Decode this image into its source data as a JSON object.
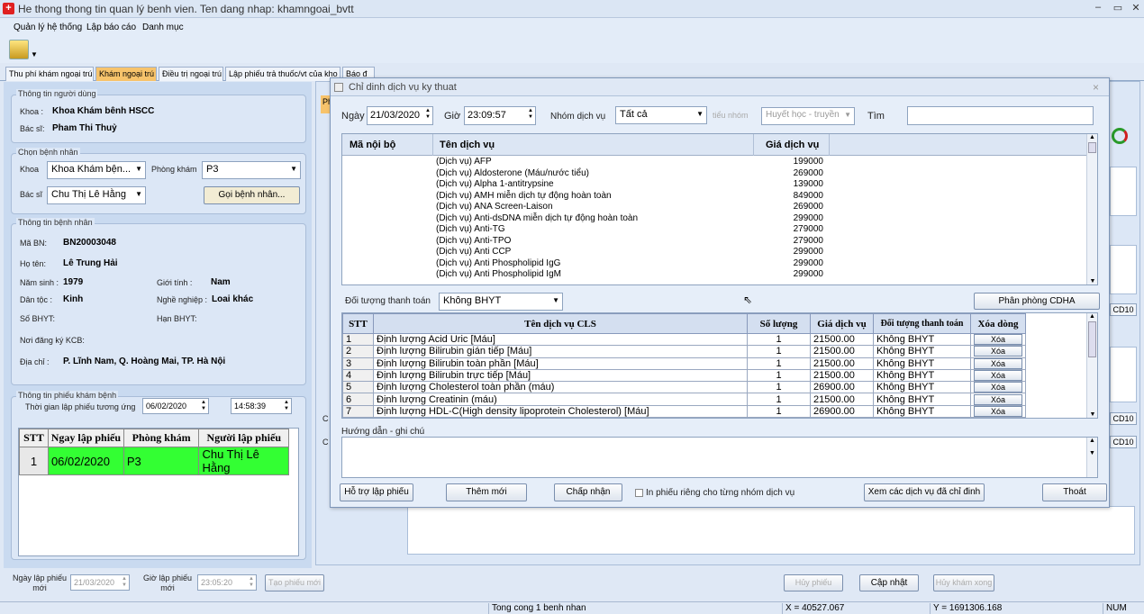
{
  "window": {
    "title": "He thong thong tin quan lý benh vien. Ten dang nhap: khamngoai_bvtt"
  },
  "menu": [
    "Quản lý hệ thống",
    "Lập báo cáo",
    "Danh mục"
  ],
  "tabs": [
    "Thu phí khám ngoại trú",
    "Khám ngoại trú",
    "Điều trị ngoại trú",
    "Lập phiếu trả thuốc/vt của kho",
    "Báo đ"
  ],
  "user": {
    "group": "Thông tin người dùng",
    "khoa_label": "Khoa :",
    "khoa": "Khoa Khám bênh  HSCC",
    "bacsi_label": "Bác sĩ:",
    "bacsi": "Pham Thi Thuỷ"
  },
  "choose": {
    "group": "Chọn bệnh nhân",
    "khoa_label": "Khoa",
    "khoa": "Khoa Khám bện...",
    "phong_label": "Phòng khám",
    "phong": "P3",
    "bacsi_label": "Bác sĩ",
    "bacsi": "Chu Thị Lê Hằng",
    "call_btn": "Gọi bệnh nhân..."
  },
  "patient": {
    "group": "Thông tin bệnh nhân",
    "ma_label": "Mã BN:",
    "ma": "BN20003048",
    "ten_label": "Họ tên:",
    "ten": "Lê Trung Hải",
    "namsinh_label": "Năm sinh :",
    "namsinh": "1979",
    "gioitinh_label": "Giới tính :",
    "gioitinh": "Nam",
    "dantoc_label": "Dân tộc :",
    "dantoc": "Kinh",
    "nghe_label": "Nghề nghiệp :",
    "nghe": "Loai khác",
    "bhyt_label": "Số BHYT:",
    "hanbhyt_label": "Hạn BHYT:",
    "noidk_label": "Nơi đăng ký KCB:",
    "diachi_label": "Địa chỉ :",
    "diachi": "P. Lĩnh Nam, Q. Hoàng Mai, TP. Hà Nội"
  },
  "ticket": {
    "group": "Thông tin phiếu khám bệnh",
    "time_label": "Thời gian lập phiếu tương ứng",
    "date": "06/02/2020",
    "time": "14:58:39",
    "headers": [
      "STT",
      "Ngay lập phiếu",
      "Phòng khám",
      "Người lập phiếu"
    ],
    "rows": [
      [
        "1",
        "06/02/2020",
        "P3",
        "Chu Thị Lê Hằng"
      ]
    ]
  },
  "bottom": {
    "ngay_label": "Ngày lập phiếu mới",
    "ngay": "21/03/2020",
    "gio_label": "Giờ lập phiếu mới",
    "gio": "23:05:20",
    "tao_btn": "Tạo phiếu mới",
    "huy_btn": "Hủy phiếu",
    "capnhat_btn": "Cập nhật",
    "huykham_btn": "Hủy khám xong"
  },
  "right_stub": {
    "cd1": "CD10",
    "cd2": "CD10",
    "cd3": "CD10",
    "c1": "C",
    "c2": "C",
    "ph": "Ph"
  },
  "dialog": {
    "title": "Chỉ dinh dịch vụ  ky thuat",
    "ngay_label": "Ngày",
    "ngay": "21/03/2020",
    "gio_label": "Giờ",
    "gio": "23:09:57",
    "nhom_label": "Nhóm dịch vụ",
    "nhom": "Tất cả",
    "tieunhom_label": "tiểu nhóm",
    "tieunhom": "Huyết học - truyền",
    "tim_label": "Tìm",
    "svc_headers": [
      "Mã nội bộ",
      "Tên dịch vụ",
      "Giá dịch vụ"
    ],
    "services": [
      [
        "(Dịch vụ) AFP",
        "199000"
      ],
      [
        "(Dịch vụ) Aldosterone (Máu/nước tiểu)",
        "269000"
      ],
      [
        "(Dịch vụ) Alpha 1-antitrypsine",
        "139000"
      ],
      [
        "(Dịch vụ) AMH miễn dịch tự động hoàn toàn",
        "849000"
      ],
      [
        "(Dịch vụ) ANA Screen-Laison",
        "269000"
      ],
      [
        "(Dịch vụ) Anti-dsDNA miễn dịch tự động hoàn toàn",
        "299000"
      ],
      [
        "(Dịch vụ) Anti-TG",
        "279000"
      ],
      [
        "(Dịch vụ) Anti-TPO",
        "279000"
      ],
      [
        "(Dịch vụ) Anti CCP",
        "299000"
      ],
      [
        "(Dịch vụ) Anti Phospholipid IgG",
        "299000"
      ],
      [
        "(Dịch vụ) Anti Phospholipid IgM",
        "299000"
      ]
    ],
    "doituong_label": "Đối tượng thanh toán",
    "doituong": "Không BHYT",
    "phanphong_btn": "Phân phòng CDHA",
    "cls_headers": [
      "STT",
      "Tên dịch vụ CLS",
      "Số lượng",
      "Giá dịch vụ",
      "Đối tượng thanh toán",
      "Xóa dòng"
    ],
    "cls_rows": [
      [
        "1",
        "Định lượng Acid Uric [Máu]",
        "1",
        "21500.00",
        "Không BHYT",
        "Xóa"
      ],
      [
        "2",
        "Định lượng Bilirubin gián tiếp [Máu]",
        "1",
        "21500.00",
        "Không BHYT",
        "Xóa"
      ],
      [
        "3",
        "Định lượng Bilirubin toàn phần [Máu]",
        "1",
        "21500.00",
        "Không BHYT",
        "Xóa"
      ],
      [
        "4",
        "Định lượng Bilirubin trực tiếp [Máu]",
        "1",
        "21500.00",
        "Không BHYT",
        "Xóa"
      ],
      [
        "5",
        "Định lượng Cholesterol toàn phần (máu)",
        "1",
        "26900.00",
        "Không BHYT",
        "Xóa"
      ],
      [
        "6",
        "Định lượng Creatinin (máu)",
        "1",
        "21500.00",
        "Không BHYT",
        "Xóa"
      ],
      [
        "7",
        "Định lượng HDL-C(High density lipoprotein Cholesterol) [Máu]",
        "1",
        "26900.00",
        "Không BHYT",
        "Xóa"
      ]
    ],
    "huongdan_label": "Hướng dẫn - ghi chú",
    "btn_hotro": "Hỗ trợ lập phiếu",
    "btn_them": "Thêm mới",
    "btn_chapnhan": "Chấp nhận",
    "inrieng_label": "In phiếu riêng cho từng nhóm dịch vụ",
    "btn_xem": "Xem các dịch vụ đã chỉ đinh",
    "btn_thoat": "Thoát"
  },
  "status": {
    "tong": "Tong cong 1 benh nhan",
    "x": "X = 40527.067",
    "y": "Y = 1691306.168",
    "num": "NUM"
  },
  "colors": {
    "active_tab": "#f7c36b",
    "selected_row": "#33ff33"
  }
}
